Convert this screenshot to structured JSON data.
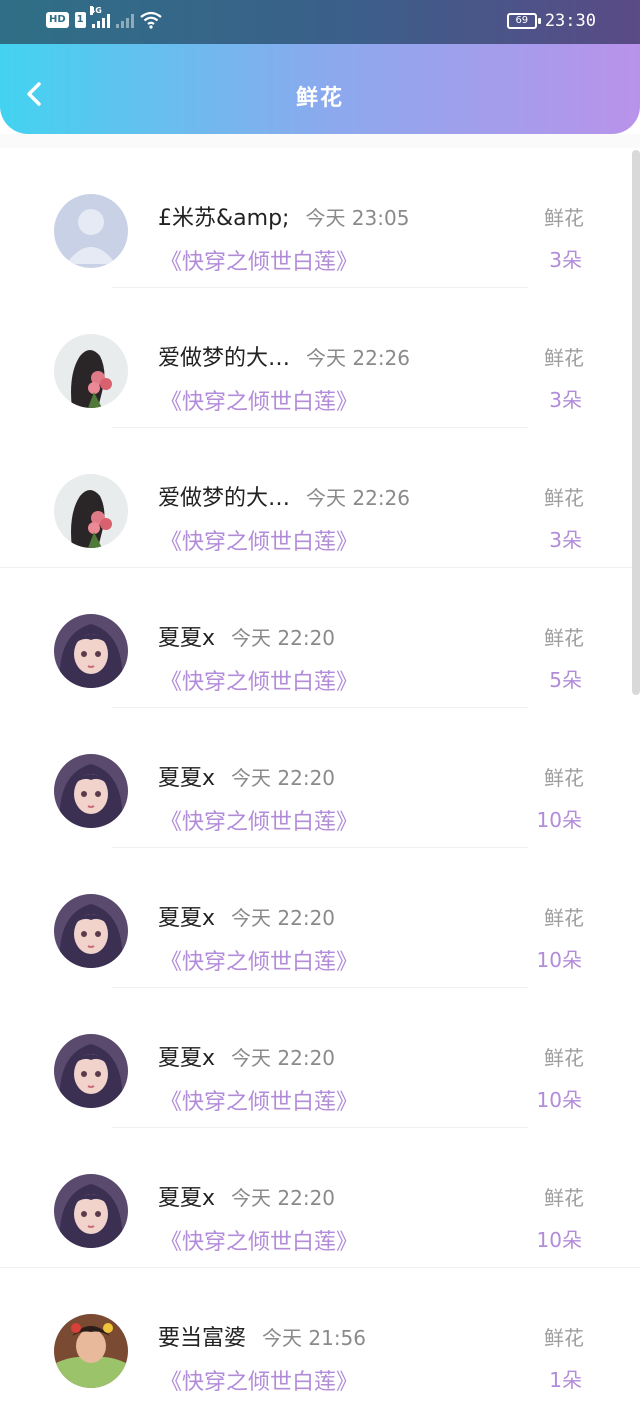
{
  "status_bar": {
    "hd_label": "HD",
    "sim_label": "1",
    "network_label": "4G",
    "battery_level": "69",
    "time": "23:30"
  },
  "header": {
    "title": "鲜花",
    "back_icon": "chevron-left-icon",
    "gradient_start": "#43d3f0",
    "gradient_end": "#b993ea"
  },
  "accent_color": "#b28bd9",
  "items": [
    {
      "name": "£米苏&amp;",
      "time": "今天 23:05",
      "book": "《快穿之倾世白莲》",
      "gift_type": "鲜花",
      "count": "3朵",
      "avatar": "default-user-avatar"
    },
    {
      "name": "爱做梦的大…",
      "time": "今天 22:26",
      "book": "《快穿之倾世白莲》",
      "gift_type": "鲜花",
      "count": "3朵",
      "avatar": "girl-with-roses-avatar"
    },
    {
      "name": "爱做梦的大…",
      "time": "今天 22:26",
      "book": "《快穿之倾世白莲》",
      "gift_type": "鲜花",
      "count": "3朵",
      "avatar": "girl-with-roses-avatar"
    },
    {
      "name": "夏夏x",
      "time": "今天 22:20",
      "book": "《快穿之倾世白莲》",
      "gift_type": "鲜花",
      "count": "5朵",
      "avatar": "anime-girl-avatar"
    },
    {
      "name": "夏夏x",
      "time": "今天 22:20",
      "book": "《快穿之倾世白莲》",
      "gift_type": "鲜花",
      "count": "10朵",
      "avatar": "anime-girl-avatar"
    },
    {
      "name": "夏夏x",
      "time": "今天 22:20",
      "book": "《快穿之倾世白莲》",
      "gift_type": "鲜花",
      "count": "10朵",
      "avatar": "anime-girl-avatar"
    },
    {
      "name": "夏夏x",
      "time": "今天 22:20",
      "book": "《快穿之倾世白莲》",
      "gift_type": "鲜花",
      "count": "10朵",
      "avatar": "anime-girl-avatar"
    },
    {
      "name": "夏夏x",
      "time": "今天 22:20",
      "book": "《快穿之倾世白莲》",
      "gift_type": "鲜花",
      "count": "10朵",
      "avatar": "anime-girl-avatar"
    },
    {
      "name": "要当富婆",
      "time": "今天 21:56",
      "book": "《快穿之倾世白莲》",
      "gift_type": "鲜花",
      "count": "1朵",
      "avatar": "girl-green-jacket-avatar"
    }
  ]
}
